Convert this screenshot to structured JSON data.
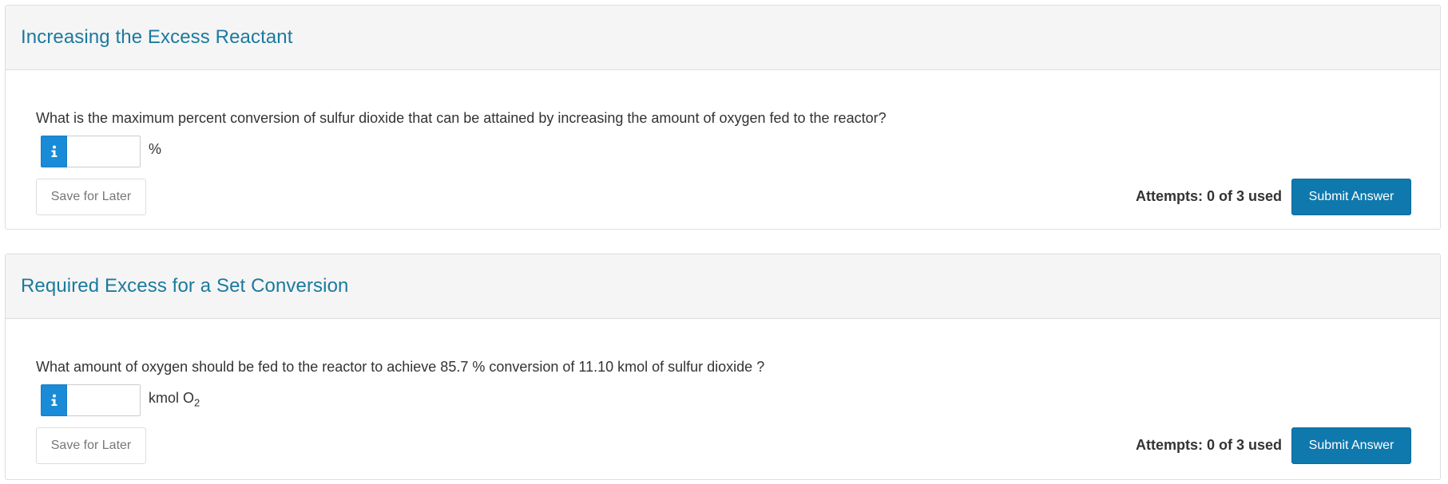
{
  "accent_color": "#1b7a9e",
  "primary_button_color": "#0f79ad",
  "info_button_color": "#1a8bd6",
  "questions": [
    {
      "title": "Increasing the Excess Reactant",
      "prompt": "What is the maximum percent conversion of sulfur dioxide that can be attained by increasing the amount of oxygen fed to the reactor?",
      "input_value": "",
      "unit": "%",
      "unit_sub": "",
      "info_icon": "info-icon",
      "save_label": "Save for Later",
      "attempts": "Attempts: 0 of 3 used",
      "submit_label": "Submit Answer"
    },
    {
      "title": "Required Excess for a Set Conversion",
      "prompt": "What amount of oxygen should be fed to the reactor to achieve 85.7 % conversion of 11.10 kmol of sulfur dioxide ?",
      "input_value": "",
      "unit": "kmol O",
      "unit_sub": "2",
      "info_icon": "info-icon",
      "save_label": "Save for Later",
      "attempts": "Attempts: 0 of 3 used",
      "submit_label": "Submit Answer"
    }
  ]
}
